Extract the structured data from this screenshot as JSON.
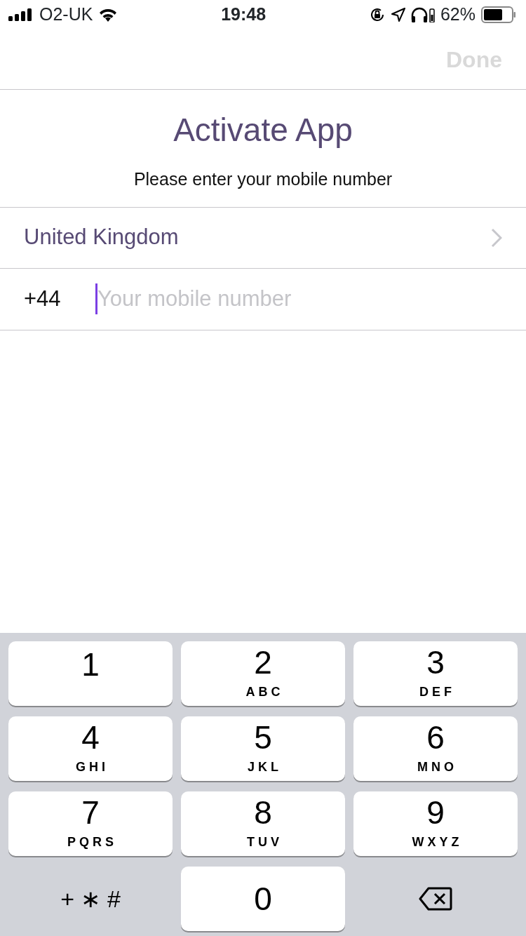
{
  "status_bar": {
    "carrier": "O2-UK",
    "time": "19:48",
    "battery": "62%"
  },
  "nav": {
    "done": {
      "label": "Done",
      "disabled": true
    }
  },
  "title": "Activate App",
  "subtitle": "Please enter your mobile number",
  "country": {
    "name": "United Kingdom"
  },
  "phone": {
    "code": "+44",
    "placeholder": "Your mobile number"
  },
  "keypad": [
    {
      "kind": "digit",
      "digit": "1"
    },
    {
      "kind": "digit",
      "digit": "2",
      "letters": "ABC"
    },
    {
      "kind": "digit",
      "digit": "3",
      "letters": "DEF"
    },
    {
      "kind": "digit",
      "digit": "4",
      "letters": "GHI"
    },
    {
      "kind": "digit",
      "digit": "5",
      "letters": "JKL"
    },
    {
      "kind": "digit",
      "digit": "6",
      "letters": "MNO"
    },
    {
      "kind": "digit",
      "digit": "7",
      "letters": "PQRS"
    },
    {
      "kind": "digit",
      "digit": "8",
      "letters": "TUV"
    },
    {
      "kind": "digit",
      "digit": "9",
      "letters": "WXYZ"
    },
    {
      "kind": "symbols",
      "digit": "+ ∗ #"
    },
    {
      "kind": "digit",
      "digit": "0"
    },
    {
      "kind": "backspace"
    }
  ]
}
